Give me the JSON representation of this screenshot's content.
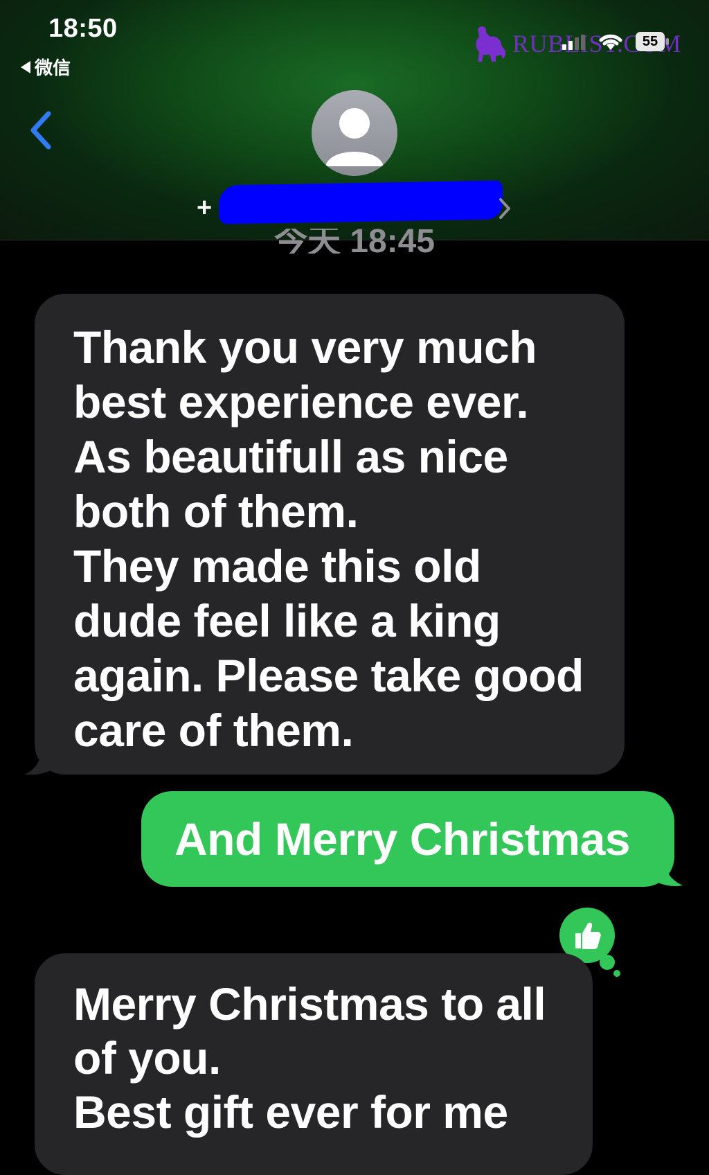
{
  "status_bar": {
    "time": "18:50",
    "back_app": "微信",
    "battery": "55",
    "watermark": "RUBLIST.COM"
  },
  "header": {
    "contact_prefix": "+",
    "timestamp": "今天 18:45"
  },
  "messages": [
    {
      "direction": "received",
      "text": "Thank you very much\nbest experience ever.\nAs beautifull as nice\nboth of them.\nThey made this old\ndude feel like a king\nagain. Please take good\ncare of them."
    },
    {
      "direction": "sent",
      "text": "And Merry Christmas",
      "tapback": "thumbs-up-icon"
    },
    {
      "direction": "received",
      "text": "Merry Christmas to all\nof you.\nBest gift ever for me"
    }
  ],
  "colors": {
    "sent_bubble": "#33c759",
    "received_bubble": "#262629",
    "accent_back": "#2f7cf6",
    "redaction": "#0000ff",
    "watermark": "#7b2fd0"
  }
}
